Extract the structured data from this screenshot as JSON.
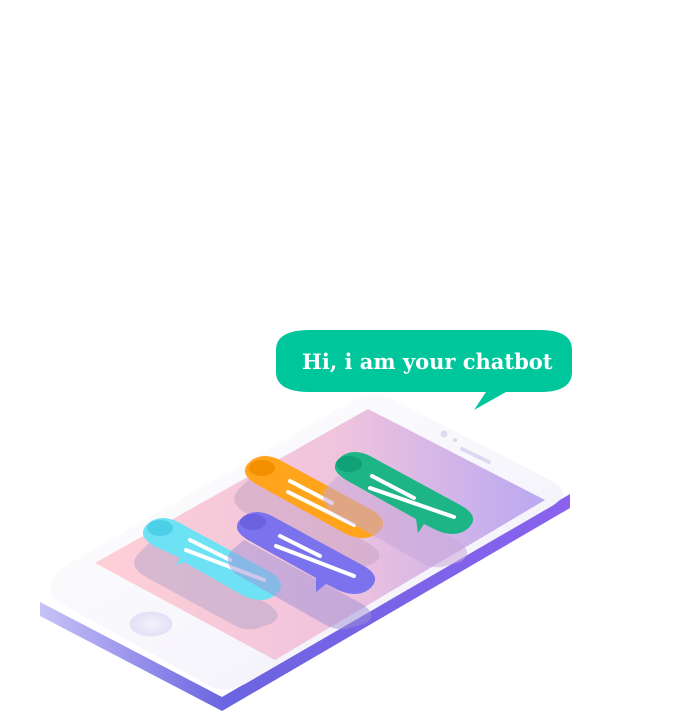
{
  "bubble": {
    "text": "Hi, i am your chatbot",
    "color": "#00c69c"
  },
  "colors": {
    "screen_start": "#ffc9d3",
    "screen_end": "#b8a9f0",
    "phone_body": "#ffffff",
    "phone_edge": "#6b5fe0",
    "msg_orange": "#ffa41b",
    "msg_green": "#1db586",
    "msg_cyan": "#6ee2f5",
    "msg_purple": "#7b73ee"
  },
  "icons": {
    "home": "home-button-icon",
    "speaker": "speaker-icon",
    "camera": "camera-icon"
  }
}
